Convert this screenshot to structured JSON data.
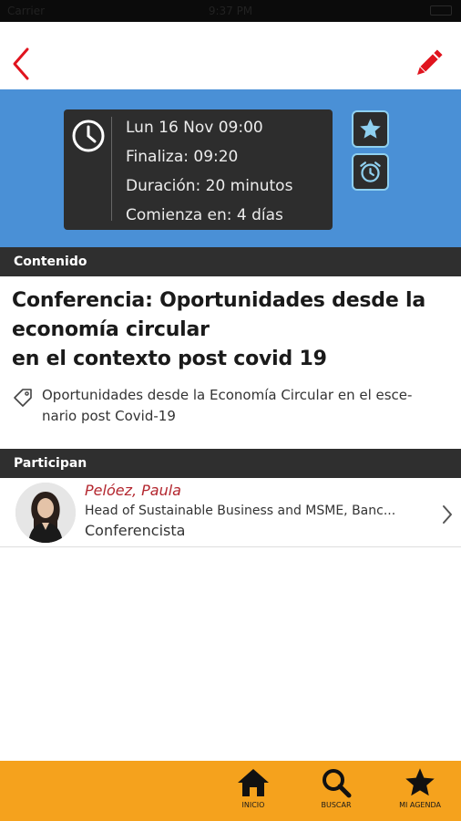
{
  "status_bar": {
    "carrier": "Carrier",
    "time": "9:37 PM"
  },
  "nav": {
    "back_icon": "chevron-left-icon",
    "edit_icon": "pencil-icon",
    "accent_color": "#e0141e"
  },
  "event": {
    "date_line": "Lun 16  Nov  09:00",
    "end_line": "Finaliza: 09:20",
    "duration_line": "Duración: 20 minutos",
    "starts_line": "Comienza en: 4 días",
    "hero_color": "#4a90d6"
  },
  "sections": {
    "content": "Contenido",
    "participants": "Participan"
  },
  "content": {
    "title_lines": [
      "Conferencia: Oportunidades desde la",
      "economía circular",
      "en el contexto post covid 19"
    ],
    "tag_lines": [
      "Oportunidades desde la Economía Circular en el esce-",
      "nario post Covid-19"
    ]
  },
  "participant": {
    "name": "Pelóez, Paula",
    "role": "Head of Sustainable Business and MSME, Banc...",
    "type": "Conferencista"
  },
  "tabs": [
    {
      "label": "INICIO",
      "icon": "home-icon"
    },
    {
      "label": "BUSCAR",
      "icon": "search-icon"
    },
    {
      "label": "MI AGENDA",
      "icon": "star-icon"
    }
  ],
  "tab_bar_color": "#f5a21d"
}
